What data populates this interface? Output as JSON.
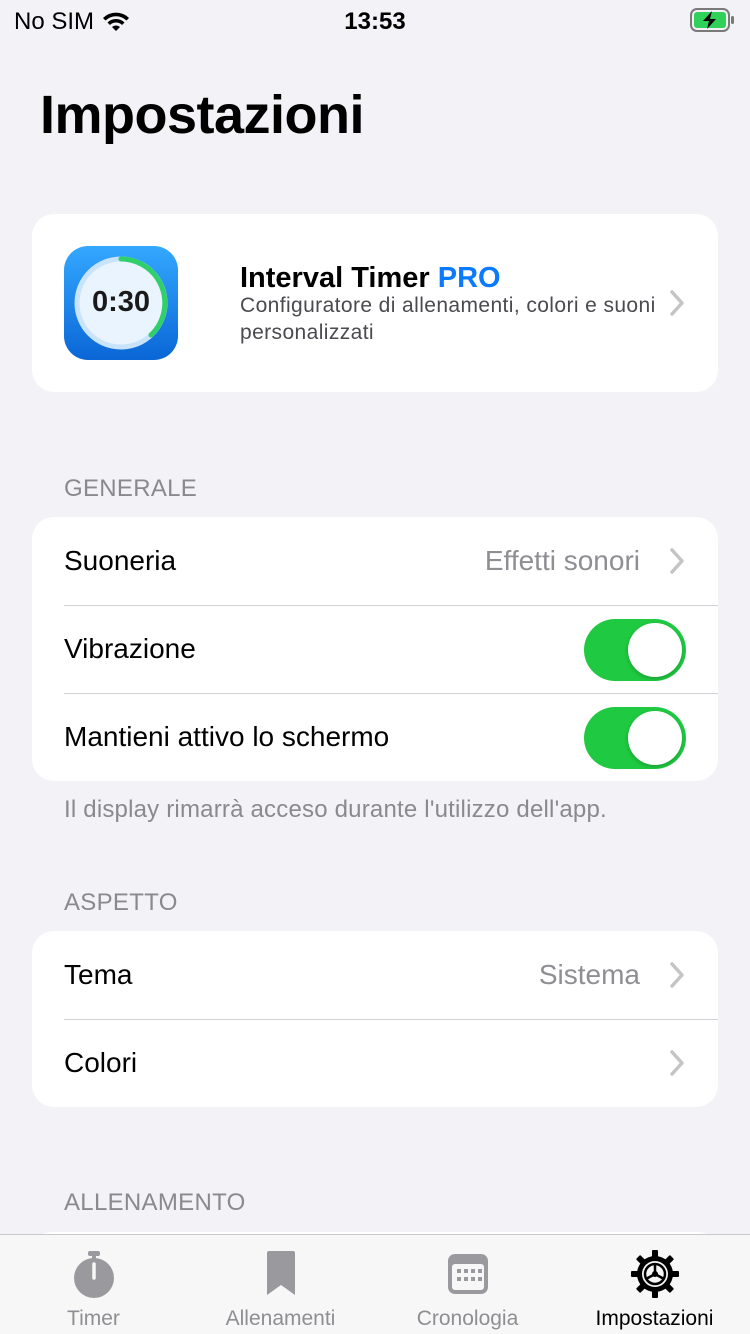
{
  "status": {
    "carrier": "No SIM",
    "time": "13:53"
  },
  "page_title": "Impostazioni",
  "pro": {
    "icon_text": "0:30",
    "title": "Interval Timer",
    "badge": "PRO",
    "description": "Configuratore di allenamenti, colori e suoni personalizzati"
  },
  "sections": {
    "generale": {
      "header": "GENERALE",
      "suoneria_label": "Suoneria",
      "suoneria_value": "Effetti sonori",
      "vibrazione_label": "Vibrazione",
      "vibrazione_on": true,
      "schermo_label": "Mantieni attivo lo schermo",
      "schermo_on": true,
      "footnote": "Il display rimarrà acceso durante l'utilizzo dell'app."
    },
    "aspetto": {
      "header": "ASPETTO",
      "tema_label": "Tema",
      "tema_value": "Sistema",
      "colori_label": "Colori"
    },
    "allenamento": {
      "header": "ALLENAMENTO"
    }
  },
  "tabs": [
    {
      "label": "Timer",
      "icon": "stopwatch-icon",
      "active": false
    },
    {
      "label": "Allenamenti",
      "icon": "bookmark-icon",
      "active": false
    },
    {
      "label": "Cronologia",
      "icon": "calendar-icon",
      "active": false
    },
    {
      "label": "Impostazioni",
      "icon": "gear-icon",
      "active": true
    }
  ],
  "colors": {
    "accent": "#0a7aff",
    "toggle_on": "#1fc941",
    "background": "#f2f2f7"
  }
}
